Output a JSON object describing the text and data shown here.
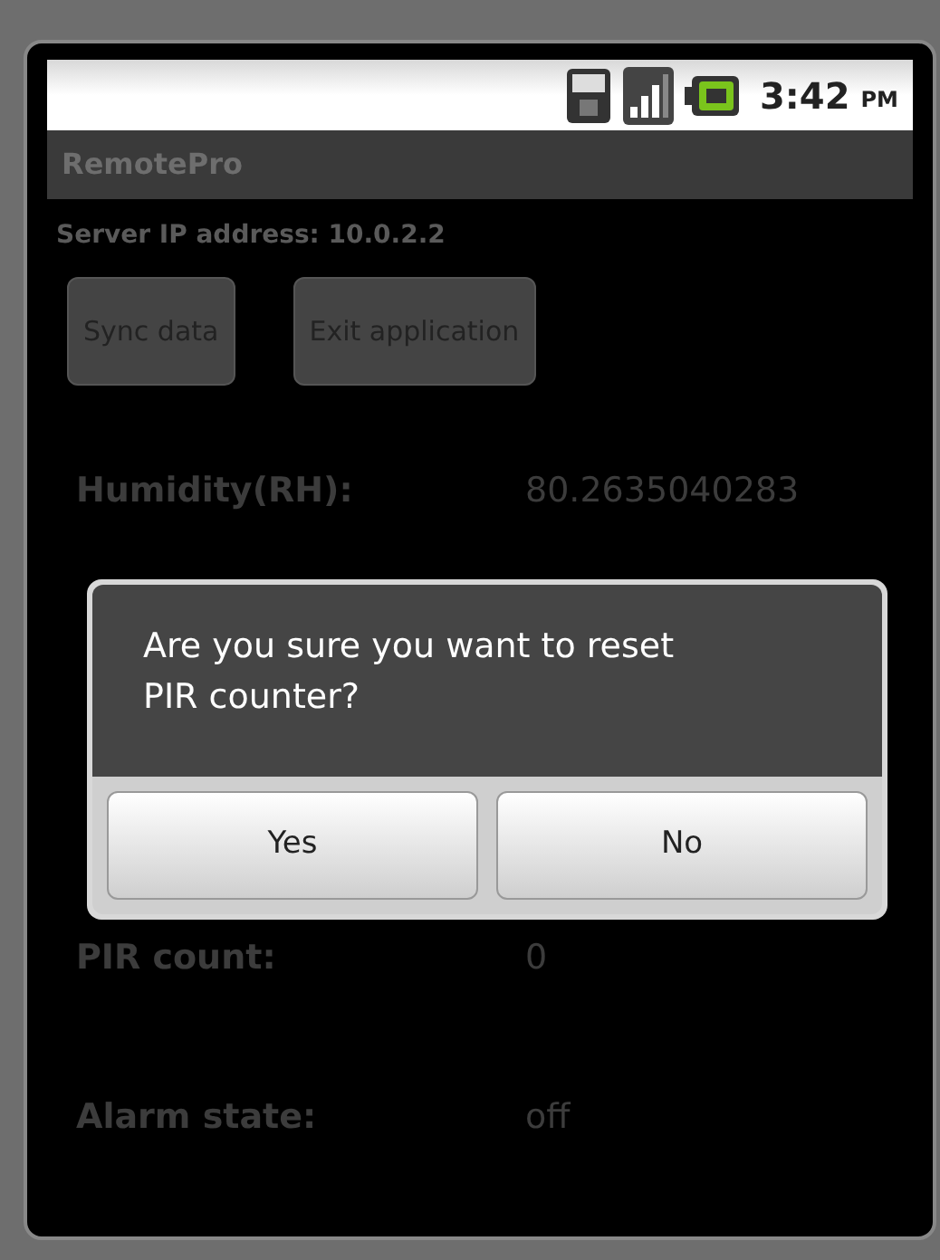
{
  "status_bar": {
    "time": "3:42",
    "ampm": "PM"
  },
  "app_title": "RemotePro",
  "server_ip": "Server IP address: 10.0.2.2",
  "buttons": [
    "Sync data",
    "Exit application"
  ],
  "readings": [
    {
      "label": "Humidity(RH):",
      "value": "80.2635040283"
    },
    {
      "label": "PIR count:",
      "value": "0"
    },
    {
      "label": "Alarm state:",
      "value": "off"
    }
  ],
  "dialog": {
    "message": "Are you sure you want to reset PIR counter?",
    "buttons": [
      "Yes",
      "No"
    ]
  }
}
